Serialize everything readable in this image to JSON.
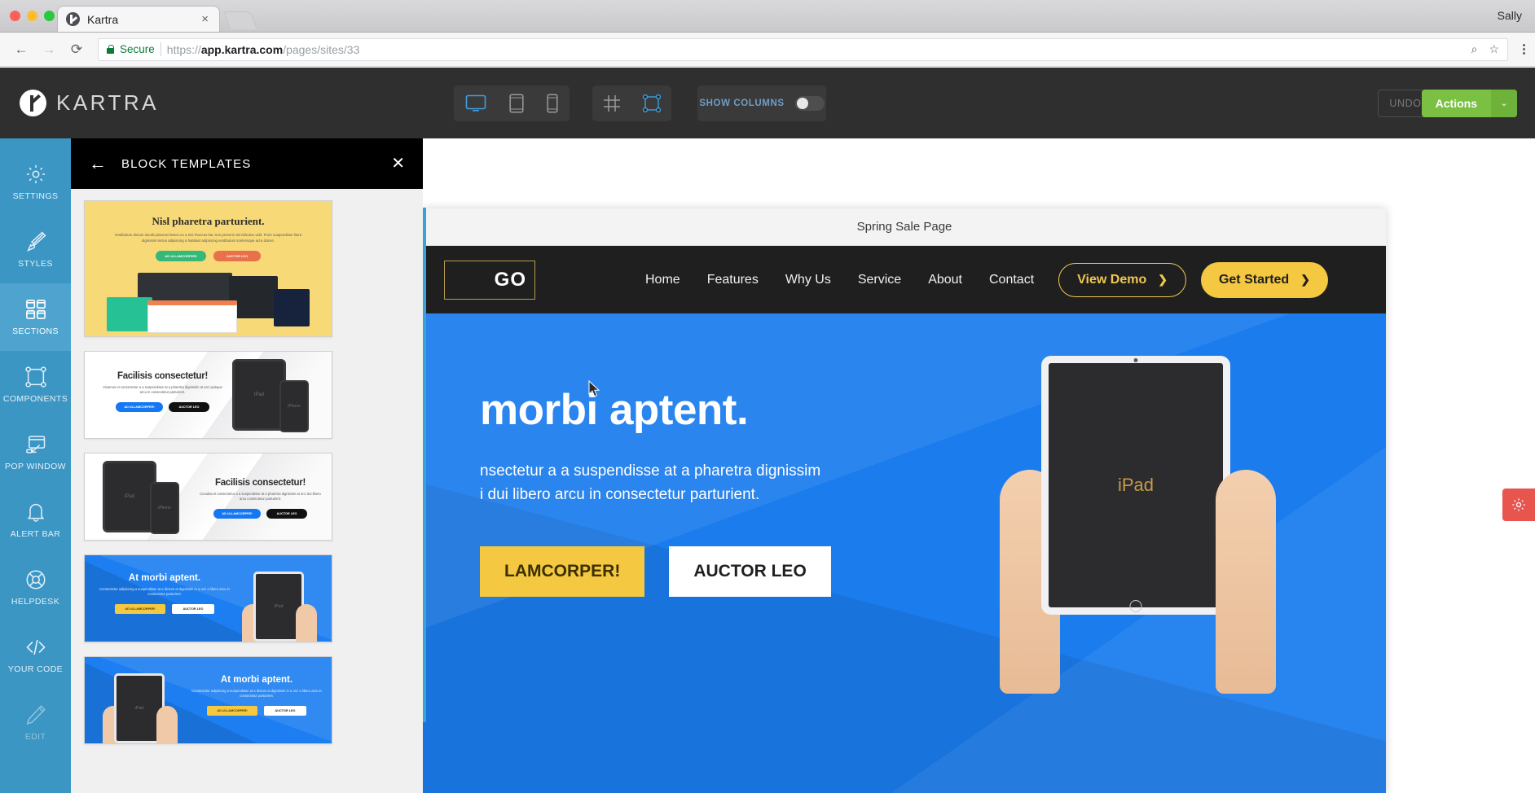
{
  "browser": {
    "tab_title": "Kartra",
    "tab_close": "×",
    "profile": "Sally",
    "back_icon": "←",
    "forward_icon": "→",
    "reload_icon": "⟳",
    "secure_label": "Secure",
    "url_bold": "app.kartra.com",
    "url_rest": "/pages/sites/33",
    "url_scheme": "https://",
    "zoom_icon": "⌕",
    "star_icon": "☆"
  },
  "app_header": {
    "brand": "KARTRA",
    "devices": [
      "desktop-icon",
      "tablet-icon",
      "mobile-icon"
    ],
    "tools": [
      "grid-icon",
      "frame-icon"
    ],
    "show_columns_label": "SHOW COLUMNS",
    "show_columns_on": false,
    "undo_label": "UNDO",
    "actions_label": "Actions",
    "actions_caret": "⌄",
    "accent_green": "#7ac143",
    "accent_blue": "#3c96c4"
  },
  "rail": {
    "items": [
      {
        "label": "SETTINGS",
        "icon": "gear-icon",
        "active": false,
        "dim": false
      },
      {
        "label": "STYLES",
        "icon": "brush-icon",
        "active": false,
        "dim": false
      },
      {
        "label": "SECTIONS",
        "icon": "sections-icon",
        "active": true,
        "dim": false
      },
      {
        "label": "COMPONENTS",
        "icon": "components-icon",
        "active": false,
        "dim": false
      },
      {
        "label": "POP WINDOW",
        "icon": "popwindow-icon",
        "active": false,
        "dim": false
      },
      {
        "label": "ALERT BAR",
        "icon": "bell-icon",
        "active": false,
        "dim": false
      },
      {
        "label": "HELPDESK",
        "icon": "lifebuoy-icon",
        "active": false,
        "dim": false
      },
      {
        "label": "YOUR CODE",
        "icon": "code-icon",
        "active": false,
        "dim": false
      },
      {
        "label": "EDIT",
        "icon": "pencil-icon",
        "active": false,
        "dim": true
      }
    ]
  },
  "panel": {
    "title": "BLOCK TEMPLATES",
    "back_icon": "←",
    "close_icon": "✕",
    "templates": [
      {
        "style": "yellow",
        "title": "Nisl pharetra parturient.",
        "sub": "Vestibulum dictum iaculis placerat fames eu a nisi rhoncus hac non present nisl ridiculus velit. Proin suspendisse litora dignissim lectus adipiscing a habitant adipiscing vestibulum scelerisque ad a dolore.",
        "buttons": [
          "AD ULLAMCORPER!",
          "AUCTOR LEO"
        ]
      },
      {
        "style": "white-right",
        "title": "Facilisis consectetur!",
        "sub": "Vivamus et consectetur a a suspendisse at a pharetra dignissim at orci quisque arcu in consectetur parturient.",
        "buttons": [
          "AD ULLAMCORPER!",
          "AUCTOR LEO"
        ],
        "devices": [
          "iPad",
          "iPhone"
        ]
      },
      {
        "style": "white-left",
        "title": "Facilisis consectetur!",
        "sub": "Conubia et consectetur a a suspendisse at a pharetra dignissim at orci dui libero arcu consectetur parturient.",
        "buttons": [
          "AD ULLAMCORPER!",
          "AUCTOR LEO"
        ],
        "devices": [
          "iPad",
          "iPhone"
        ]
      },
      {
        "style": "blue",
        "title": "At morbi aptent.",
        "sub": "Consectetur adipiscing a suspendisse at a dictum at dignissim in a orci a libero arcu in consectetur parturient.",
        "buttons": [
          "AD ULLAMCORPER!",
          "AUCTOR LEO"
        ],
        "devices": [
          "iPad"
        ]
      },
      {
        "style": "blue",
        "title": "At morbi aptent.",
        "sub": "Consectetur adipiscing a suspendisse at a dictum at dignissim in a orci a libero arcu in consectetur parturient.",
        "buttons": [
          "AD ULLAMCORPER!",
          "AUCTOR LEO"
        ],
        "devices": [
          "iPad"
        ]
      }
    ]
  },
  "canvas": {
    "page_title": "Spring Sale Page",
    "site": {
      "logo_text": "GO",
      "nav_links": [
        "Home",
        "Features",
        "Why Us",
        "Service",
        "About",
        "Contact"
      ],
      "cta_outline": "View Demo",
      "cta_solid": "Get Started",
      "chevron": "❯",
      "hero_heading": "morbi aptent.",
      "hero_paragraph_line1": "nsectetur a a suspendisse at a pharetra dignissim",
      "hero_paragraph_line2": "i dui libero arcu in consectetur parturient.",
      "hero_btn_primary": "LAMCORPER!",
      "hero_btn_secondary": "AUCTOR LEO",
      "device_label": "iPad",
      "hero_bg": "#1b7ced",
      "accent_yellow": "#f5c842"
    },
    "gear_tab_icon": "gear-icon",
    "gear_tab_color": "#e8554e"
  }
}
